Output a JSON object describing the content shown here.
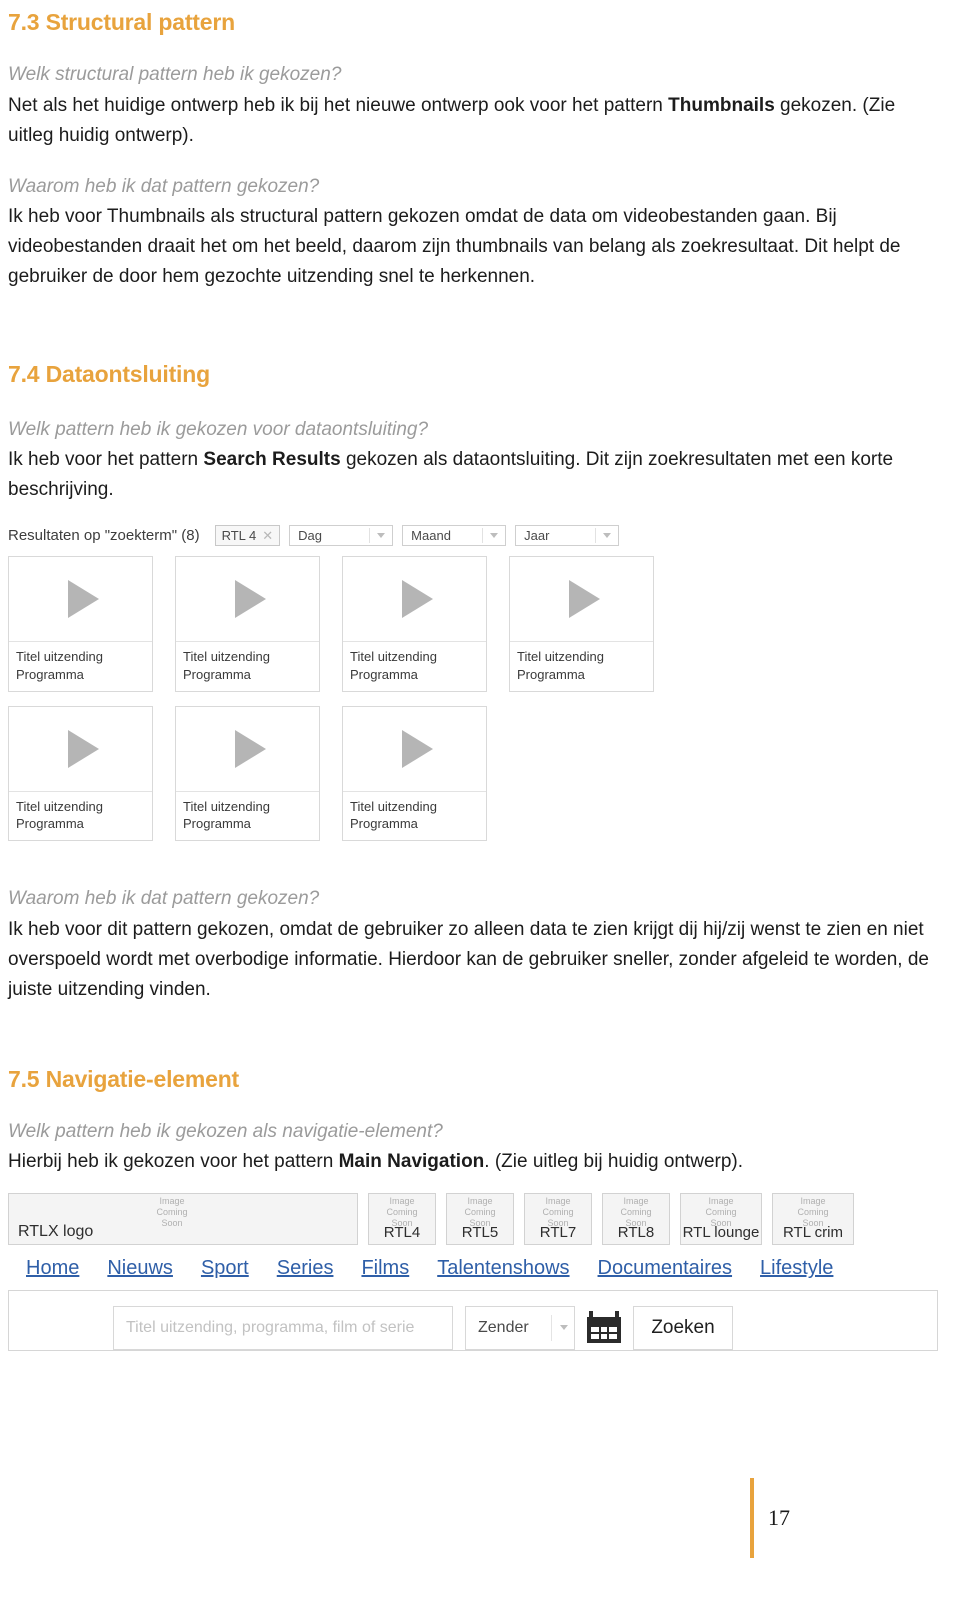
{
  "sections": {
    "s73": {
      "heading": "7.3 Structural pattern",
      "q1": "Welk structural pattern heb ik gekozen?",
      "a1_pre": "Net als het huidige ontwerp heb ik bij het nieuwe ontwerp ook voor het pattern ",
      "a1_bold": "Thumbnails",
      "a1_post": " gekozen. (Zie uitleg huidig ontwerp).",
      "q2": "Waarom heb ik dat pattern gekozen?",
      "a2": "Ik heb voor Thumbnails als structural pattern gekozen omdat de data om videobestanden gaan. Bij videobestanden draait het om het beeld, daarom zijn thumbnails van belang als zoekresultaat. Dit helpt de gebruiker de door hem gezochte uitzending snel te herkennen."
    },
    "s74": {
      "heading": "7.4 Dataontsluiting",
      "q1": "Welk pattern heb ik gekozen voor dataontsluiting?",
      "a1_pre": "Ik heb voor het pattern ",
      "a1_bold": "Search Results",
      "a1_post": " gekozen als dataontsluiting. Dit zijn zoekresultaten met een korte beschrijving.",
      "q2": "Waarom heb ik dat pattern gekozen?",
      "a2": "Ik heb voor dit pattern gekozen, omdat de gebruiker zo alleen data te zien krijgt dij hij/zij wenst te zien en niet overspoeld wordt met overbodige informatie. Hierdoor kan de gebruiker sneller, zonder afgeleid te worden, de juiste uitzending vinden."
    },
    "s75": {
      "heading": "7.5 Navigatie-element",
      "q1": "Welk pattern heb ik gekozen als navigatie-element?",
      "a1_pre": "Hierbij heb ik gekozen voor het pattern ",
      "a1_bold": "Main Navigation",
      "a1_post": ". (Zie uitleg bij huidig ontwerp)."
    }
  },
  "search_mockup": {
    "results_title": "Resultaten op \"zoekterm\" (8)",
    "chip": {
      "label": "RTL 4",
      "remove_icon": "close-icon",
      "remove_glyph": "✕"
    },
    "filters": [
      {
        "label": "Dag"
      },
      {
        "label": "Maand"
      },
      {
        "label": "Jaar"
      }
    ],
    "cards": [
      {
        "title": "Titel uitzending",
        "subtitle": "Programma"
      },
      {
        "title": "Titel uitzending",
        "subtitle": "Programma"
      },
      {
        "title": "Titel uitzending",
        "subtitle": "Programma"
      },
      {
        "title": "Titel uitzending",
        "subtitle": "Programma"
      },
      {
        "title": "Titel uitzending",
        "subtitle": "Programma"
      },
      {
        "title": "Titel uitzending",
        "subtitle": "Programma"
      },
      {
        "title": "Titel uitzending",
        "subtitle": "Programma"
      }
    ],
    "play_icon": "play-icon"
  },
  "nav_mockup": {
    "placeholder_image_text": "Image\nComing\nSoon",
    "placeholder_lines": [
      "Image",
      "Coming",
      "Soon"
    ],
    "logo_main_label": "RTLX logo",
    "channel_tiles": [
      {
        "label": "RTL4"
      },
      {
        "label": "RTL5"
      },
      {
        "label": "RTL7"
      },
      {
        "label": "RTL8"
      },
      {
        "label": "RTL lounge"
      },
      {
        "label": "RTL crim"
      }
    ],
    "nav_links": [
      {
        "label": "Home"
      },
      {
        "label": "Nieuws"
      },
      {
        "label": "Sport"
      },
      {
        "label": "Series"
      },
      {
        "label": "Films"
      },
      {
        "label": "Talentenshows"
      },
      {
        "label": "Documentaires"
      },
      {
        "label": "Lifestyle"
      }
    ],
    "search": {
      "placeholder": "Titel uitzending, programma, film of serie",
      "select_label": "Zender",
      "calendar_icon": "calendar-icon",
      "button_label": "Zoeken"
    }
  },
  "footer": {
    "page_number": "17"
  },
  "colors": {
    "heading_orange": "#E8A33D",
    "question_grey": "#9b9b9b",
    "link_blue": "#2f5fa8"
  }
}
